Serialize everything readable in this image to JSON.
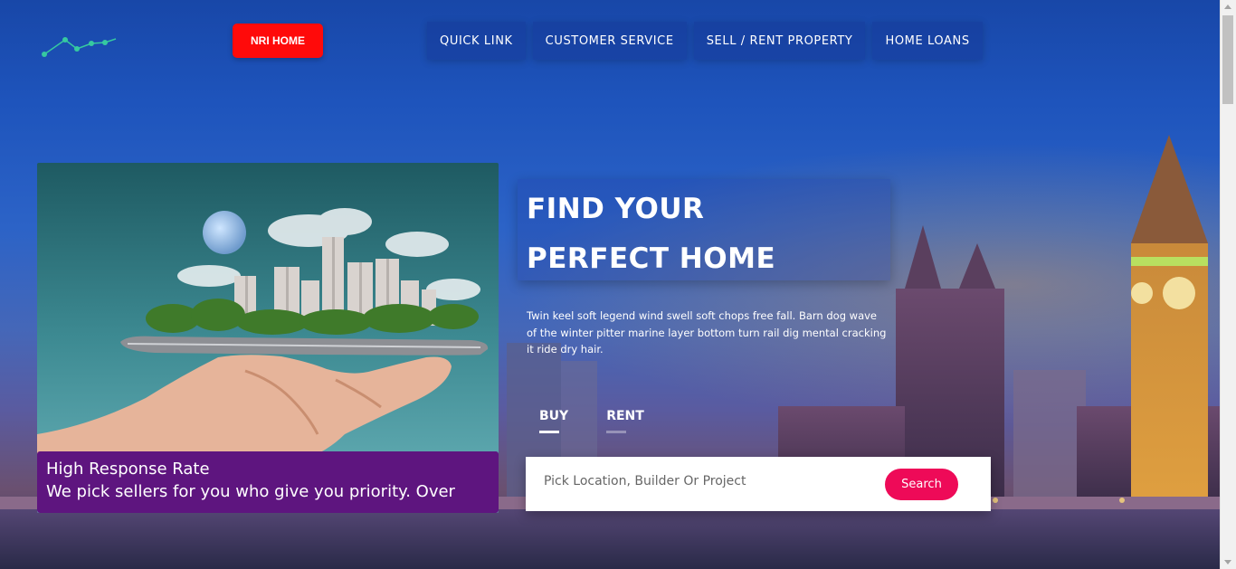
{
  "header": {
    "logo_icon": "line-chart-logo-icon",
    "nri_button_label": "NRI HOME",
    "nav": [
      {
        "label": "QUICK LINK"
      },
      {
        "label": "CUSTOMER SERVICE"
      },
      {
        "label": "SELL / RENT PROPERTY"
      },
      {
        "label": "HOME LOANS"
      }
    ]
  },
  "hero_card": {
    "image": "hand-holding-phone-with-city-buildings-image",
    "caption_title": "High Response Rate",
    "caption_text": "We pick sellers for you who give you priority. Over"
  },
  "main": {
    "headline_line1": "FIND YOUR",
    "headline_line2": "PERFECT HOME",
    "description": "Twin keel soft legend wind swell soft chops free fall. Barn dog wave of the winter pitter marine layer bottom turn rail dig mental cracking it ride dry hair.",
    "tabs": [
      {
        "label": "BUY",
        "active": true
      },
      {
        "label": "RENT",
        "active": false
      }
    ],
    "search": {
      "placeholder": "Pick Location, Builder Or Project",
      "value": "",
      "button_label": "Search"
    }
  },
  "colors": {
    "nri_button": "#ff0a0a",
    "search_button": "#ee0a58",
    "caption_bg": "#5e157f",
    "header_bg": "#1847a8"
  }
}
